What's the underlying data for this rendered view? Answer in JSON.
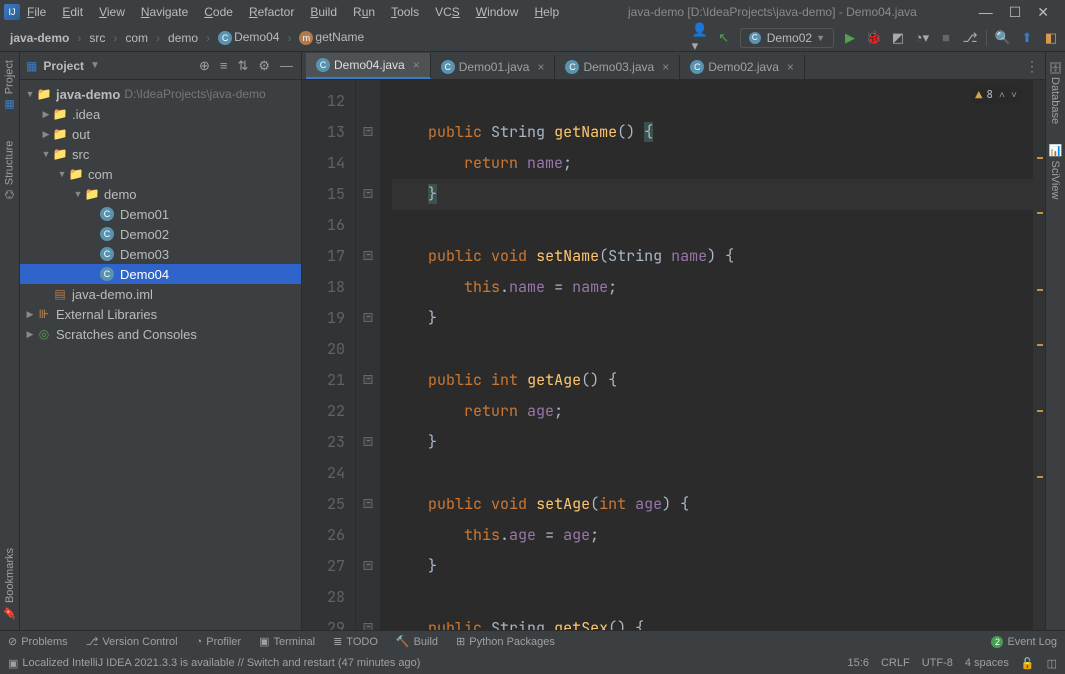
{
  "window": {
    "title": "java-demo [D:\\IdeaProjects\\java-demo] - Demo04.java"
  },
  "menu": {
    "file": "File",
    "edit": "Edit",
    "view": "View",
    "navigate": "Navigate",
    "code": "Code",
    "refactor": "Refactor",
    "build": "Build",
    "run": "Run",
    "tools": "Tools",
    "vcs": "VCS",
    "window": "Window",
    "help": "Help"
  },
  "breadcrumb": {
    "project": "java-demo",
    "src": "src",
    "pkg1": "com",
    "pkg2": "demo",
    "class": "Demo04",
    "method": "getName"
  },
  "run_config": {
    "selected": "Demo02"
  },
  "left_tools": {
    "project": "Project",
    "structure": "Structure",
    "bookmarks": "Bookmarks"
  },
  "right_tools": {
    "database": "Database",
    "sciview": "SciView"
  },
  "project_panel": {
    "title": "Project"
  },
  "tree": {
    "root": "java-demo",
    "root_hint": "D:\\IdeaProjects\\java-demo",
    "idea": ".idea",
    "out": "out",
    "src": "src",
    "com": "com",
    "demo": "demo",
    "demo01": "Demo01",
    "demo02": "Demo02",
    "demo03": "Demo03",
    "demo04": "Demo04",
    "iml": "java-demo.iml",
    "ext": "External Libraries",
    "scratch": "Scratches and Consoles"
  },
  "tabs": {
    "t0": "Demo04.java",
    "t1": "Demo01.java",
    "t2": "Demo03.java",
    "t3": "Demo02.java"
  },
  "warnings": {
    "count": "8"
  },
  "code": {
    "line_start": 12,
    "lines": [
      "",
      "    public String getName() {",
      "        return name;",
      "    }",
      "",
      "    public void setName(String name) {",
      "        this.name = name;",
      "    }",
      "",
      "    public int getAge() {",
      "        return age;",
      "    }",
      "",
      "    public void setAge(int age) {",
      "        this.age = age;",
      "    }",
      "",
      "    public String getSex() {"
    ]
  },
  "bottom": {
    "problems": "Problems",
    "vcs": "Version Control",
    "profiler": "Profiler",
    "terminal": "Terminal",
    "todo": "TODO",
    "build": "Build",
    "python": "Python Packages",
    "eventlog": "Event Log"
  },
  "status": {
    "message": "Localized IntelliJ IDEA 2021.3.3 is available // Switch and restart (47 minutes ago)",
    "position": "15:6",
    "lineending": "CRLF",
    "encoding": "UTF-8",
    "indent": "4 spaces"
  }
}
